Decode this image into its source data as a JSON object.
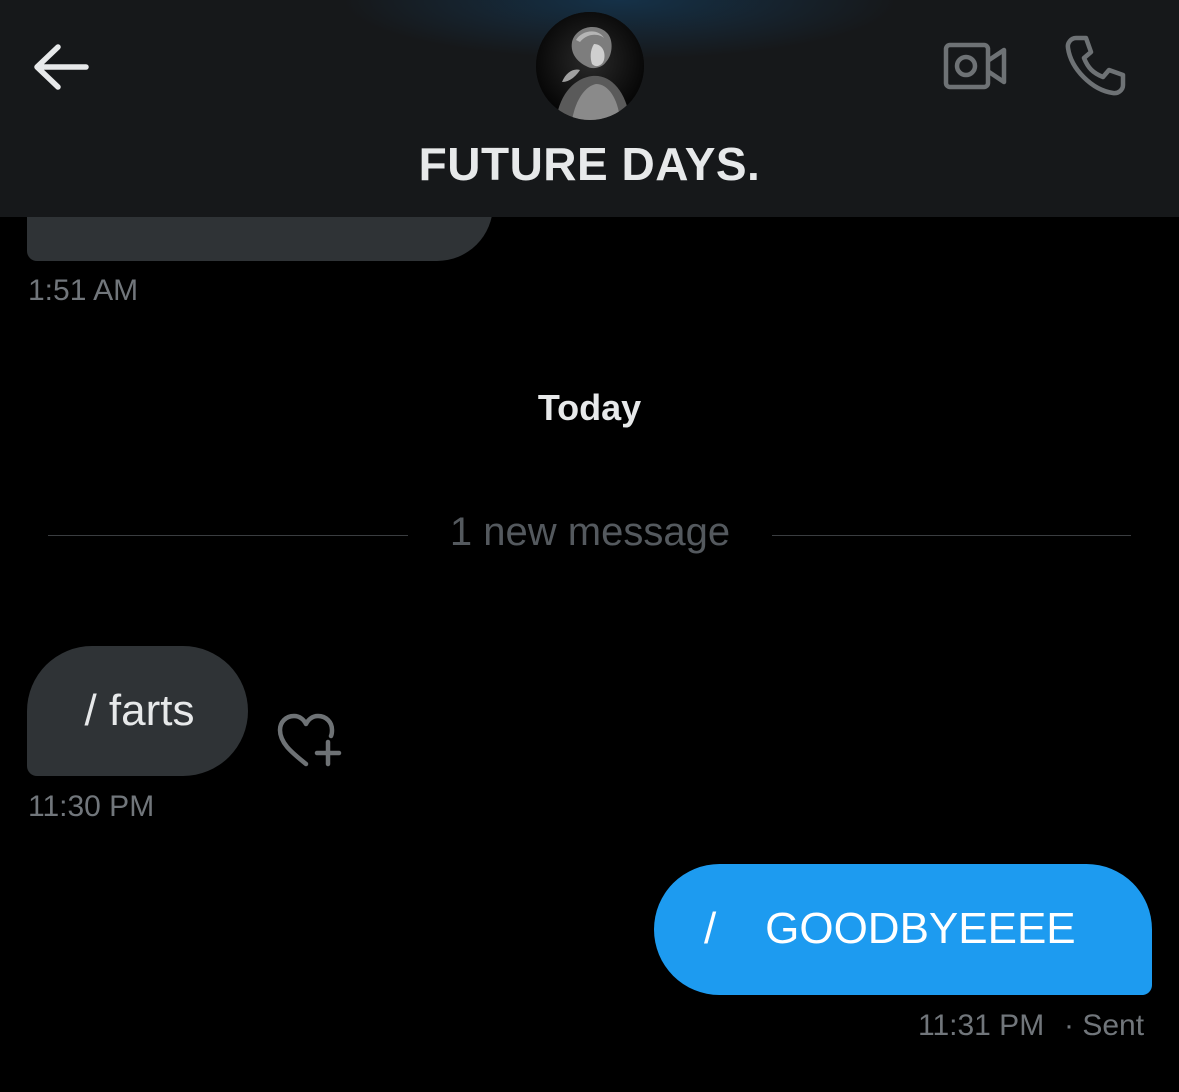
{
  "header": {
    "title": "FUTURE DAYS.",
    "back_icon": "arrow-left-icon",
    "video_icon": "video-camera-icon",
    "phone_icon": "phone-icon"
  },
  "messages": {
    "previous": {
      "time": "1:51 AM"
    },
    "day_separator": "Today",
    "new_messages_divider": "1 new message",
    "received": {
      "text": "/ farts",
      "time": "11:30 PM",
      "reaction_icon": "heart-plus-icon"
    },
    "sent": {
      "text": "/    GOODBYEEEE",
      "time": "11:31 PM",
      "status": "· Sent"
    }
  },
  "colors": {
    "background": "#000000",
    "header": "#16181a",
    "received_bubble": "#2f3336",
    "sent_bubble": "#1d9bf0",
    "muted_text": "#71767b"
  }
}
